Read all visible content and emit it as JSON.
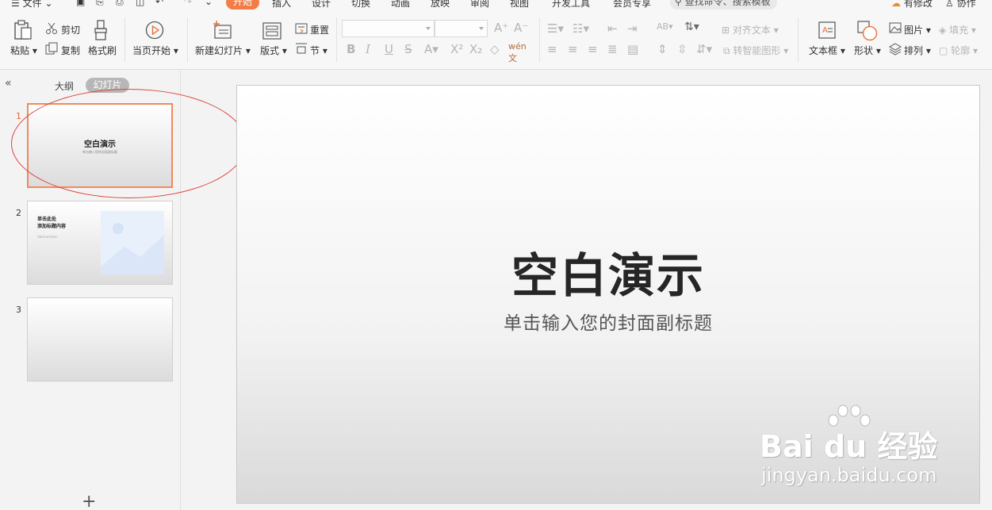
{
  "menubar": {
    "file": "文件",
    "tabs": [
      "开始",
      "插入",
      "设计",
      "切换",
      "动画",
      "放映",
      "审阅",
      "视图",
      "开发工具",
      "会员专享"
    ],
    "active_tab": "开始",
    "search": "查找命令、搜索模板",
    "unsaved": "有修改",
    "collab": "协作"
  },
  "ribbon": {
    "paste": "粘贴",
    "cut": "剪切",
    "copy": "复制",
    "format_painter": "格式刷",
    "from_current": "当页开始",
    "new_slide": "新建幻灯片",
    "layout": "版式",
    "reset": "重置",
    "section": "节",
    "align_text": "对齐文本",
    "smart_graphic": "转智能图形",
    "text_box": "文本框",
    "shape": "形状",
    "picture": "图片",
    "fill": "填充",
    "arrange": "排列",
    "outline": "轮廓",
    "font_name": "",
    "font_size": ""
  },
  "leftpane": {
    "tab_outline": "大纲",
    "tab_slides": "幻灯片",
    "slides": [
      {
        "num": "1",
        "title": "空白演示",
        "subtitle": "单击输入您的封面副标题"
      },
      {
        "num": "2",
        "title_line1": "单击此处",
        "title_line2": "添加标题内容",
        "subtitle": "Abstractitem"
      },
      {
        "num": "3"
      }
    ],
    "add": "+"
  },
  "slide": {
    "title": "空白演示",
    "subtitle": "单击输入您的封面副标题"
  },
  "watermark": {
    "brand": "Bai du 经验",
    "site": "jingyan.baidu.com"
  },
  "colors": {
    "accent": "#f27d48",
    "annotation": "#d9453c"
  }
}
